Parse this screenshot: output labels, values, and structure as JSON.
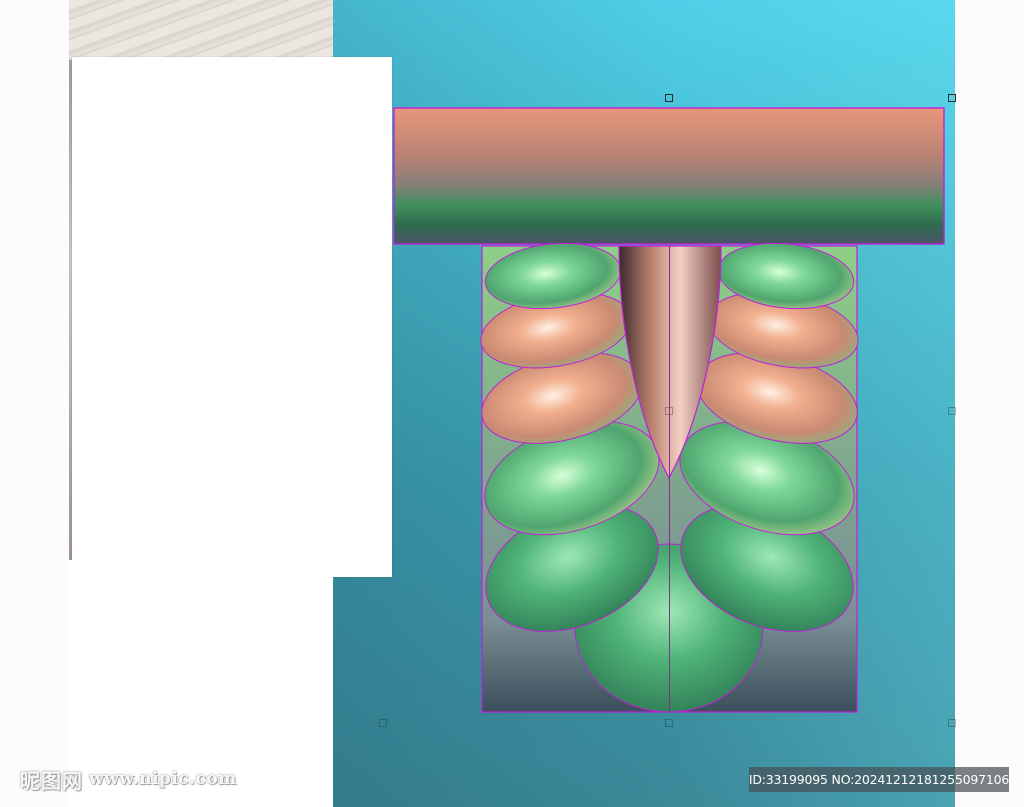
{
  "watermark": {
    "brand": "昵图网",
    "url": "www.nipic.com"
  },
  "badge": {
    "text": "ID:33199095 NO:20241212181255097106"
  },
  "colors": {
    "viewport_top": "#4fd0e8",
    "viewport_bottom": "#3a8898",
    "selection_outline": "#c21fd8",
    "relief_peach": "#f0a07c",
    "relief_green": "#5cc48a"
  },
  "icons": {
    "selection_handle": "square-handle-icon"
  }
}
